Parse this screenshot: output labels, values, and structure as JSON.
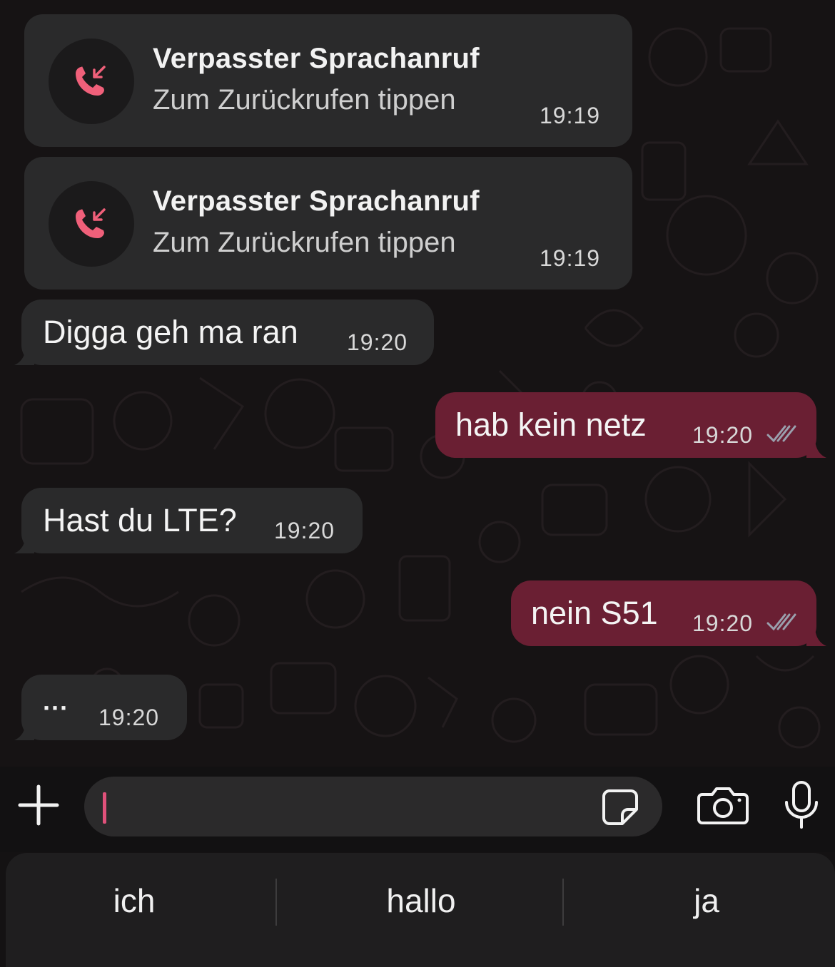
{
  "messages": {
    "call1": {
      "title": "Verpasster Sprachanruf",
      "subtitle": "Zum Zurückrufen tippen",
      "time": "19:19"
    },
    "call2": {
      "title": "Verpasster Sprachanruf",
      "subtitle": "Zum Zurückrufen tippen",
      "time": "19:19"
    },
    "m1": {
      "text": "Digga geh ma ran",
      "time": "19:20",
      "direction": "incoming"
    },
    "m2": {
      "text": "hab kein netz",
      "time": "19:20",
      "direction": "outgoing",
      "status": "read"
    },
    "m3": {
      "text": "Hast du LTE?",
      "time": "19:20",
      "direction": "incoming"
    },
    "m4": {
      "text": "nein S51",
      "time": "19:20",
      "direction": "outgoing",
      "status": "read"
    },
    "m5": {
      "text": "···",
      "time": "19:20",
      "direction": "incoming"
    }
  },
  "composer": {
    "placeholder": "",
    "icons": [
      "plus-icon",
      "sticker-icon",
      "camera-icon",
      "microphone-icon"
    ]
  },
  "keyboard": {
    "suggestions": [
      "ich",
      "hallo",
      "ja"
    ]
  },
  "colors": {
    "background": "#161314",
    "incoming_bubble": "#2a2a2b",
    "outgoing_bubble": "#6a1f33",
    "missed_call_icon": "#f0607a",
    "read_ticks": "#9aa0ad",
    "cursor": "#e0517a"
  }
}
